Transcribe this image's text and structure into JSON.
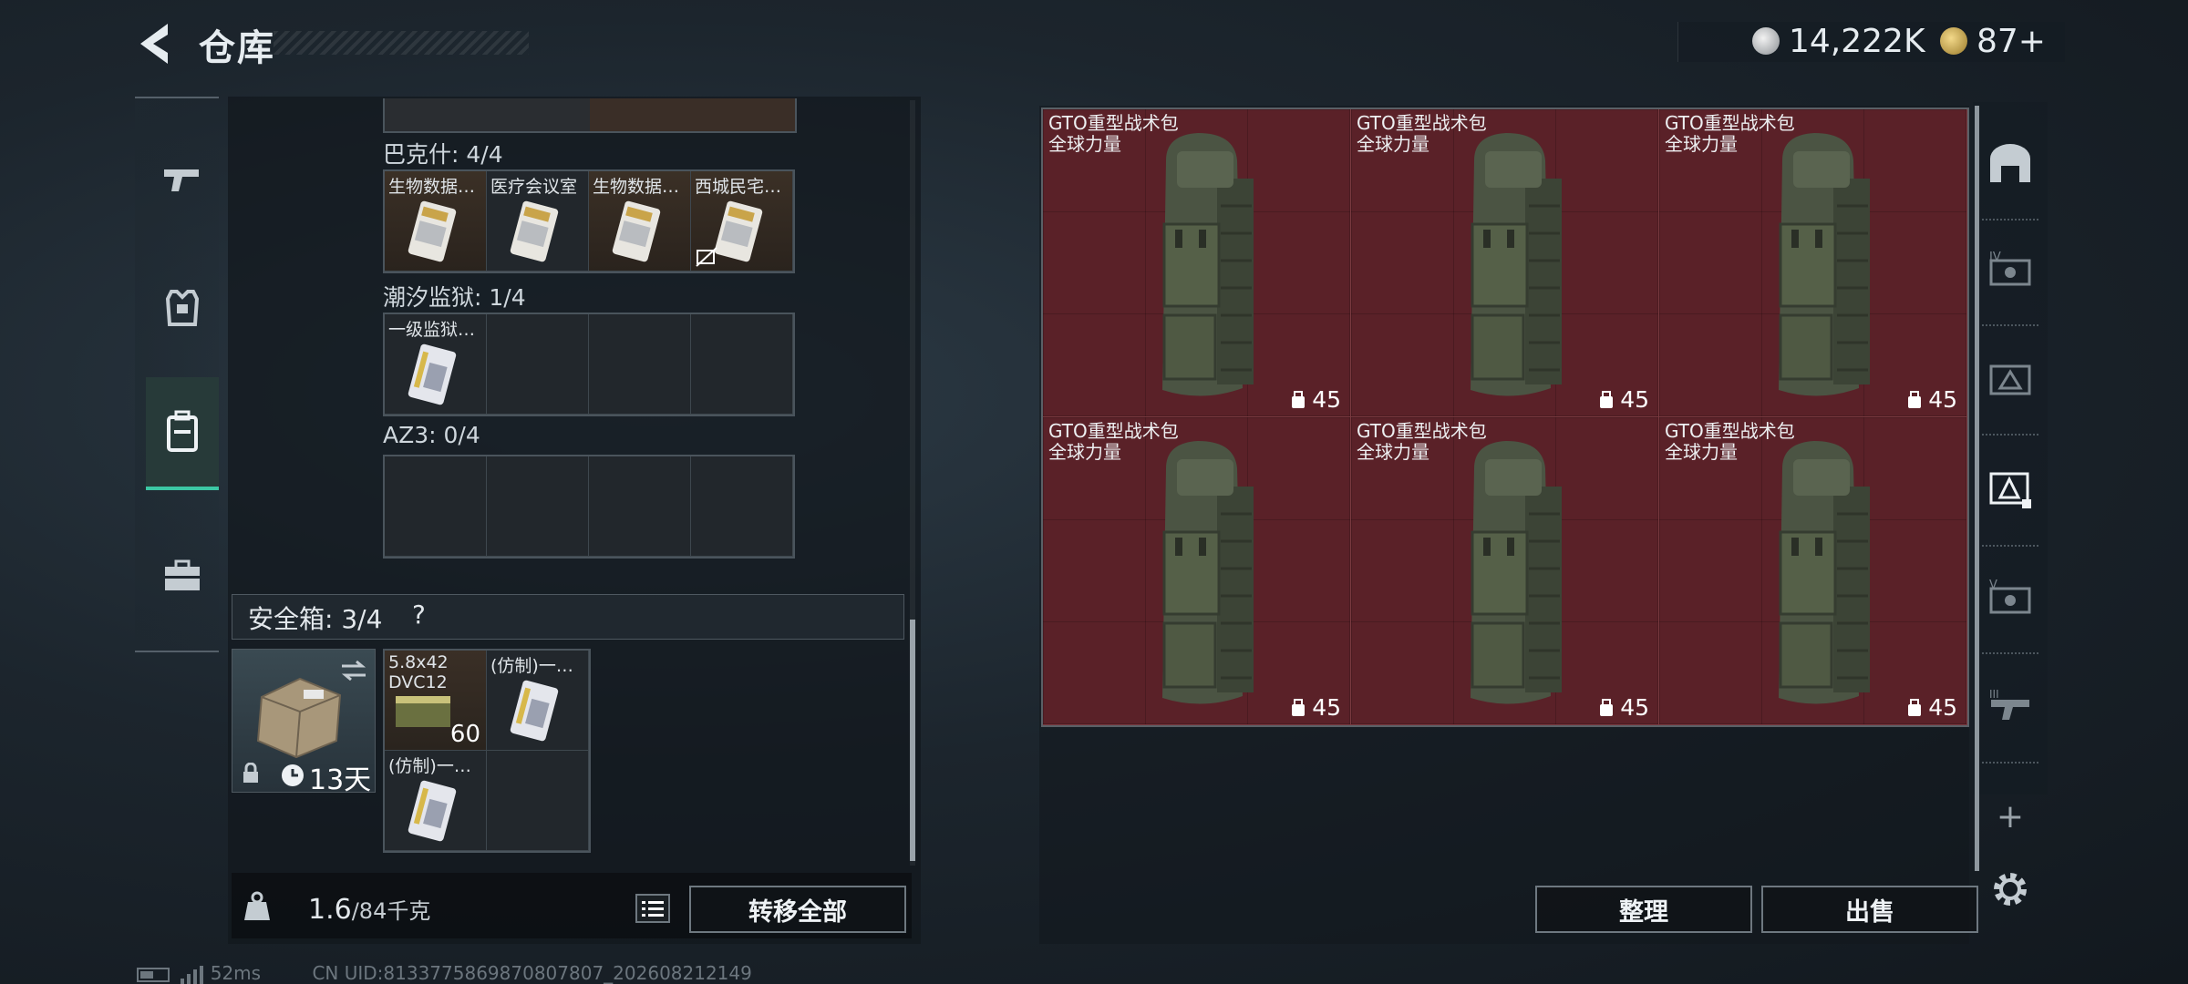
{
  "header": {
    "title": "仓库",
    "currency": [
      {
        "icon": "silver-coin-icon",
        "value": "14,222K"
      },
      {
        "icon": "gold-coin-icon",
        "value": "87+"
      }
    ]
  },
  "left_nav": {
    "items": [
      {
        "name": "weapons",
        "icon": "gun-icon",
        "active": false
      },
      {
        "name": "armor",
        "icon": "armor-vest-icon",
        "active": false
      },
      {
        "name": "backpack",
        "icon": "backpack-icon",
        "active": true
      },
      {
        "name": "case",
        "icon": "briefcase-icon",
        "active": false
      }
    ]
  },
  "keycard_sections": [
    {
      "label": "巴克什: 4/4",
      "cells": [
        "生物数据…",
        "医疗会议室",
        "生物数据…",
        "西城民宅…"
      ]
    },
    {
      "label": "潮汐监狱: 1/4",
      "cells": [
        "一级监狱…",
        "",
        "",
        ""
      ]
    },
    {
      "label": "AZ3: 0/4",
      "cells": [
        "",
        "",
        "",
        ""
      ]
    }
  ],
  "safe_box": {
    "label": "安全箱: 3/4",
    "help": "?",
    "duration": "13天",
    "items": [
      {
        "label_line1": "5.8x42",
        "label_line2": "DVC12",
        "count": "60"
      },
      {
        "label": "(仿制)一…"
      },
      {
        "label": "(仿制)一…"
      }
    ]
  },
  "bottom": {
    "weight_current": "1.6",
    "weight_max": "/84千克",
    "transfer_all": "转移全部"
  },
  "backpacks": [
    {
      "name": "GTO重型战术包",
      "sub": "全球力量",
      "level": "45"
    },
    {
      "name": "GTO重型战术包",
      "sub": "全球力量",
      "level": "45"
    },
    {
      "name": "GTO重型战术包",
      "sub": "全球力量",
      "level": "45"
    },
    {
      "name": "GTO重型战术包",
      "sub": "全球力量",
      "level": "45"
    },
    {
      "name": "GTO重型战术包",
      "sub": "全球力量",
      "level": "45"
    },
    {
      "name": "GTO重型战术包",
      "sub": "全球力量",
      "level": "45"
    }
  ],
  "actions": {
    "sort": "整理",
    "sell": "出售",
    "add": "+"
  },
  "status_bar": {
    "ping": "52ms",
    "uid": "CN UID:8133775869870807807_202608212149"
  },
  "colors": {
    "accent": "#3cc7a4",
    "backpack_bg": "#5a2128"
  }
}
